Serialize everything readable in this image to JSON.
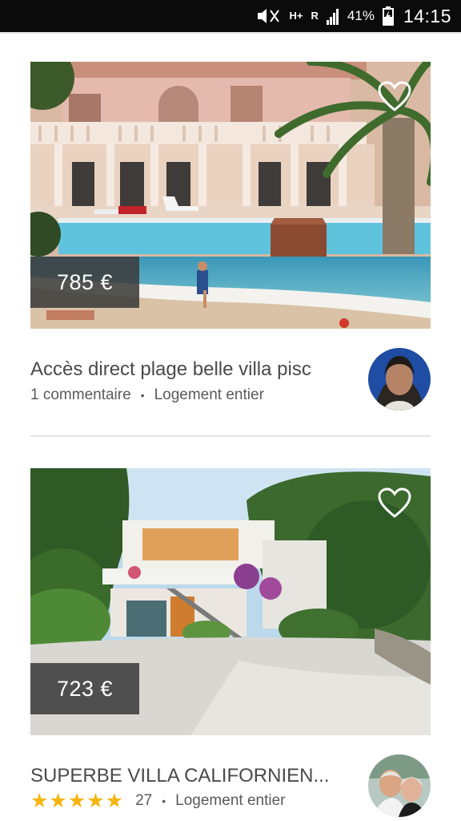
{
  "status_bar": {
    "network": "H+",
    "network_sub": "R",
    "battery": "41%",
    "time": "14:15",
    "icons": [
      "mute-icon",
      "signal-icon",
      "battery-icon"
    ]
  },
  "listings": [
    {
      "price": "785 €",
      "title": "Accès direct plage belle villa pisc",
      "reviews": "1 commentaire",
      "type": "Logement entier",
      "favorite": false
    },
    {
      "price": "723 €",
      "title": "SUPERBE VILLA CALIFORNIEN...",
      "rating_stars": 5,
      "reviews": "27",
      "type": "Logement entier",
      "favorite": false
    }
  ],
  "colors": {
    "star": "#f6b50e",
    "price_tag": "#3c3c3c",
    "text": "#4a4a4a"
  }
}
